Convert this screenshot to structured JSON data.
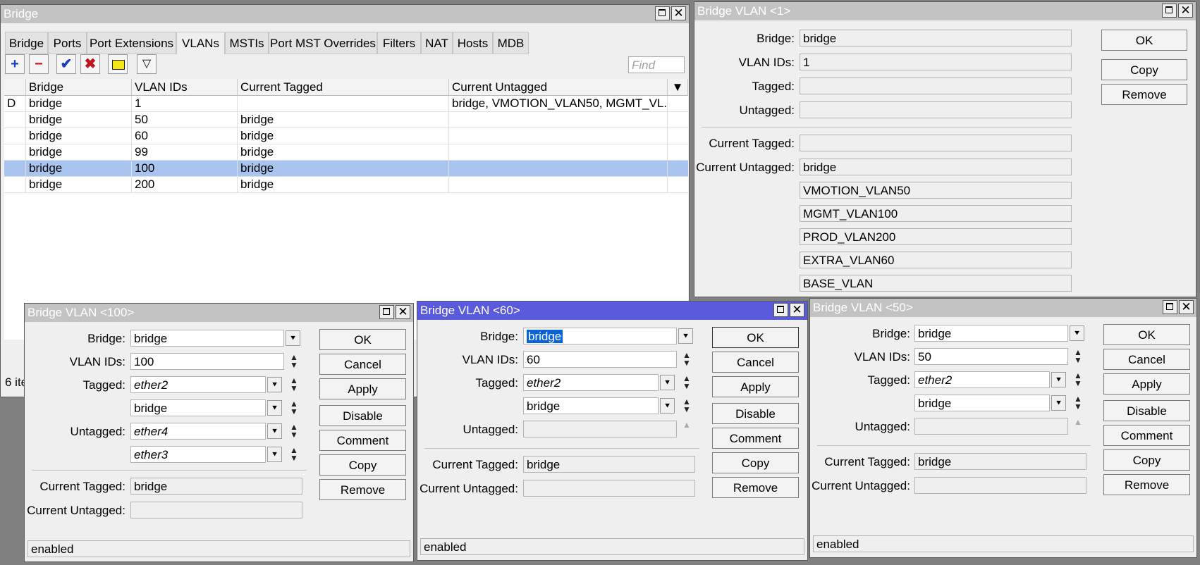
{
  "bridge_window": {
    "title": "Bridge",
    "tabs": [
      "Bridge",
      "Ports",
      "Port Extensions",
      "VLANs",
      "MSTIs",
      "Port MST Overrides",
      "Filters",
      "NAT",
      "Hosts",
      "MDB"
    ],
    "find_placeholder": "Find",
    "columns": [
      "Bridge",
      "VLAN IDs",
      "Current Tagged",
      "Current Untagged"
    ],
    "rows": [
      {
        "flag": "D",
        "bridge": "bridge",
        "vlan_ids": "1",
        "current_tagged": "",
        "current_untagged": "bridge, VMOTION_VLAN50, MGMT_VL..."
      },
      {
        "flag": "",
        "bridge": "bridge",
        "vlan_ids": "50",
        "current_tagged": "bridge",
        "current_untagged": ""
      },
      {
        "flag": "",
        "bridge": "bridge",
        "vlan_ids": "60",
        "current_tagged": "bridge",
        "current_untagged": ""
      },
      {
        "flag": "",
        "bridge": "bridge",
        "vlan_ids": "99",
        "current_tagged": "bridge",
        "current_untagged": ""
      },
      {
        "flag": "",
        "bridge": "bridge",
        "vlan_ids": "100",
        "current_tagged": "bridge",
        "current_untagged": ""
      },
      {
        "flag": "",
        "bridge": "bridge",
        "vlan_ids": "200",
        "current_tagged": "bridge",
        "current_untagged": ""
      }
    ],
    "selected_row": 4,
    "status": "6 ite"
  },
  "vlan1": {
    "title": "Bridge VLAN <1>",
    "labels": {
      "bridge": "Bridge:",
      "vlan_ids": "VLAN IDs:",
      "tagged": "Tagged:",
      "untagged": "Untagged:",
      "current_tagged": "Current Tagged:",
      "current_untagged": "Current Untagged:"
    },
    "bridge": "bridge",
    "vlan_ids": "1",
    "tagged": "",
    "untagged": "",
    "current_tagged": "",
    "current_untagged": [
      "bridge",
      "VMOTION_VLAN50",
      "MGMT_VLAN100",
      "PROD_VLAN200",
      "EXTRA_VLAN60",
      "BASE_VLAN"
    ],
    "buttons": [
      "OK",
      "Copy",
      "Remove"
    ]
  },
  "vlan100": {
    "title": "Bridge VLAN <100>",
    "labels": {
      "bridge": "Bridge:",
      "vlan_ids": "VLAN IDs:",
      "tagged": "Tagged:",
      "untagged": "Untagged:",
      "current_tagged": "Current Tagged:",
      "current_untagged": "Current Untagged:"
    },
    "bridge": "bridge",
    "vlan_ids": "100",
    "tagged": [
      "ether2",
      "bridge"
    ],
    "untagged": [
      "ether4",
      "ether3"
    ],
    "current_tagged": "bridge",
    "current_untagged": "",
    "buttons": [
      "OK",
      "Cancel",
      "Apply",
      "Disable",
      "Comment",
      "Copy",
      "Remove"
    ],
    "status": "enabled"
  },
  "vlan60": {
    "title": "Bridge VLAN <60>",
    "labels": {
      "bridge": "Bridge:",
      "vlan_ids": "VLAN IDs:",
      "tagged": "Tagged:",
      "untagged": "Untagged:",
      "current_tagged": "Current Tagged:",
      "current_untagged": "Current Untagged:"
    },
    "bridge": "bridge",
    "vlan_ids": "60",
    "tagged": [
      "ether2",
      "bridge"
    ],
    "untagged": "",
    "current_tagged": "bridge",
    "current_untagged": "",
    "buttons": [
      "OK",
      "Cancel",
      "Apply",
      "Disable",
      "Comment",
      "Copy",
      "Remove"
    ],
    "status": "enabled"
  },
  "vlan50": {
    "title": "Bridge VLAN <50>",
    "labels": {
      "bridge": "Bridge:",
      "vlan_ids": "VLAN IDs:",
      "tagged": "Tagged:",
      "untagged": "Untagged:",
      "current_tagged": "Current Tagged:",
      "current_untagged": "Current Untagged:"
    },
    "bridge": "bridge",
    "vlan_ids": "50",
    "tagged": [
      "ether2",
      "bridge"
    ],
    "untagged": "",
    "current_tagged": "bridge",
    "current_untagged": "",
    "buttons": [
      "OK",
      "Cancel",
      "Apply",
      "Disable",
      "Comment",
      "Copy",
      "Remove"
    ],
    "status": "enabled"
  }
}
